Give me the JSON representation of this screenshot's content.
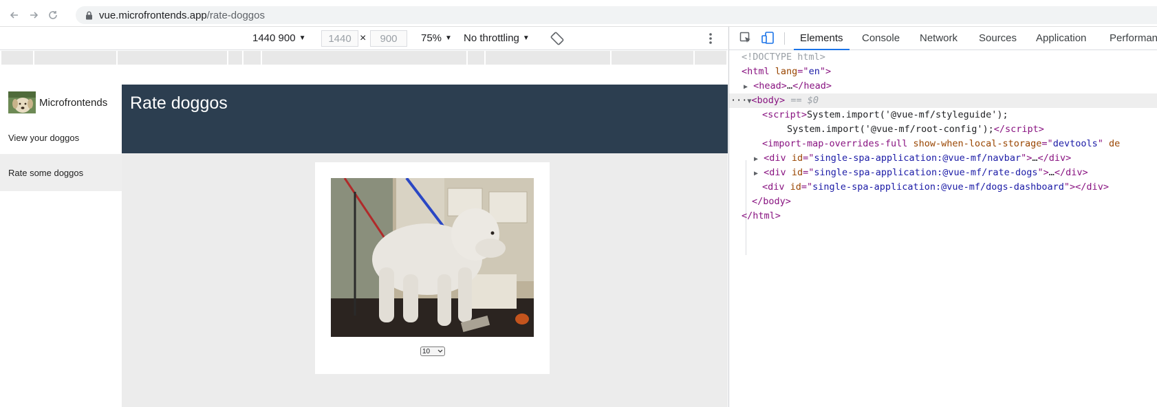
{
  "browser": {
    "url_host": "vue.microfrontends.app",
    "url_path": "/rate-doggos"
  },
  "device_toolbar": {
    "dimensions_label": "1440 900",
    "width_value": "1440",
    "height_value": "900",
    "times": "×",
    "zoom": "75%",
    "throttling": "No throttling"
  },
  "app": {
    "brand": "Microfrontends",
    "nav": [
      {
        "label": "View your doggos",
        "active": false
      },
      {
        "label": "Rate some doggos",
        "active": true
      }
    ],
    "page_title": "Rate doggos",
    "rating_value": "10"
  },
  "devtools": {
    "tabs": [
      "Elements",
      "Console",
      "Network",
      "Sources",
      "Application",
      "Performan"
    ],
    "active_tab": "Elements",
    "dom": {
      "doctype": "<!DOCTYPE html>",
      "html_lang_attr": "lang",
      "html_lang_val": "en",
      "head_collapsed": "…",
      "body_marker": "== $0",
      "script_line1": "System.import('@vue-mf/styleguide');",
      "script_line2": "System.import('@vue-mf/root-config');",
      "import_map_tag": "import-map-overrides-full",
      "import_map_attr": "show-when-local-storage",
      "import_map_val": "devtools",
      "import_map_cut": "de",
      "div_attr": "id",
      "div_navbar": "single-spa-application:@vue-mf/navbar",
      "div_rate_dogs": "single-spa-application:@vue-mf/rate-dogs",
      "div_dashboard": "single-spa-application:@vue-mf/dogs-dashboard",
      "ellipsis": "…"
    }
  },
  "colors": {
    "header_bg": "#2c3e50",
    "devtools_accent": "#1a73e8",
    "tag": "#881280",
    "attr": "#994500",
    "value": "#1a1aa6"
  },
  "icons": [
    "back-arrow-icon",
    "forward-arrow-icon",
    "reload-icon",
    "lock-icon",
    "rotate-icon",
    "more-vertical-icon",
    "inspect-element-icon",
    "device-toggle-icon"
  ]
}
